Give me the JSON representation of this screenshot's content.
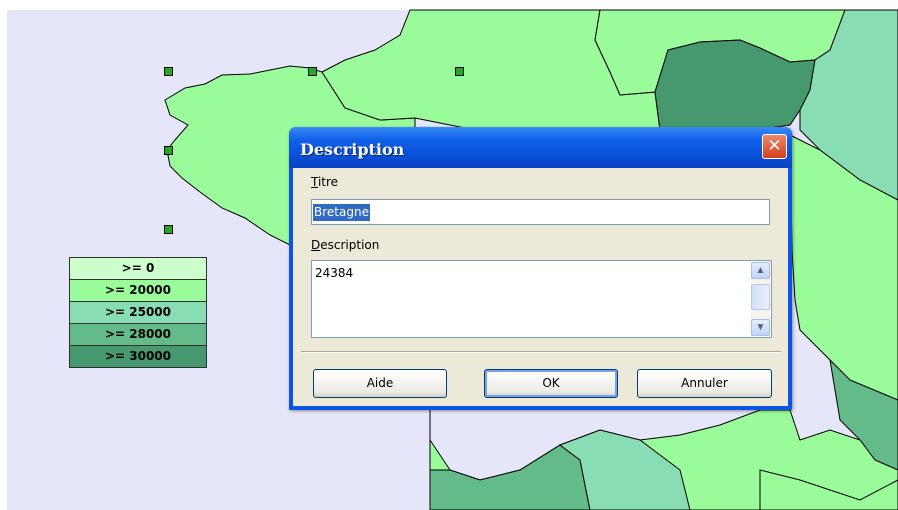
{
  "legend": {
    "rows": [
      {
        "label": ">= 0",
        "color": "#ccffcc"
      },
      {
        "label": ">= 20000",
        "color": "#9afb9a"
      },
      {
        "label": ">= 25000",
        "color": "#88ddb4"
      },
      {
        "label": ">= 28000",
        "color": "#62bb89"
      },
      {
        "label": ">= 30000",
        "color": "#46996f"
      }
    ]
  },
  "map": {
    "background_color": "#e6e6fa"
  },
  "dialog": {
    "title": "Description",
    "close_glyph": "✕",
    "titre_label_accel": "T",
    "titre_label_rest": "itre",
    "titre_value": "Bretagne",
    "description_label_accel": "D",
    "description_label_rest": "escription",
    "description_value": "24384",
    "buttons": {
      "help": "Aide",
      "ok": "OK",
      "cancel": "Annuler"
    }
  }
}
